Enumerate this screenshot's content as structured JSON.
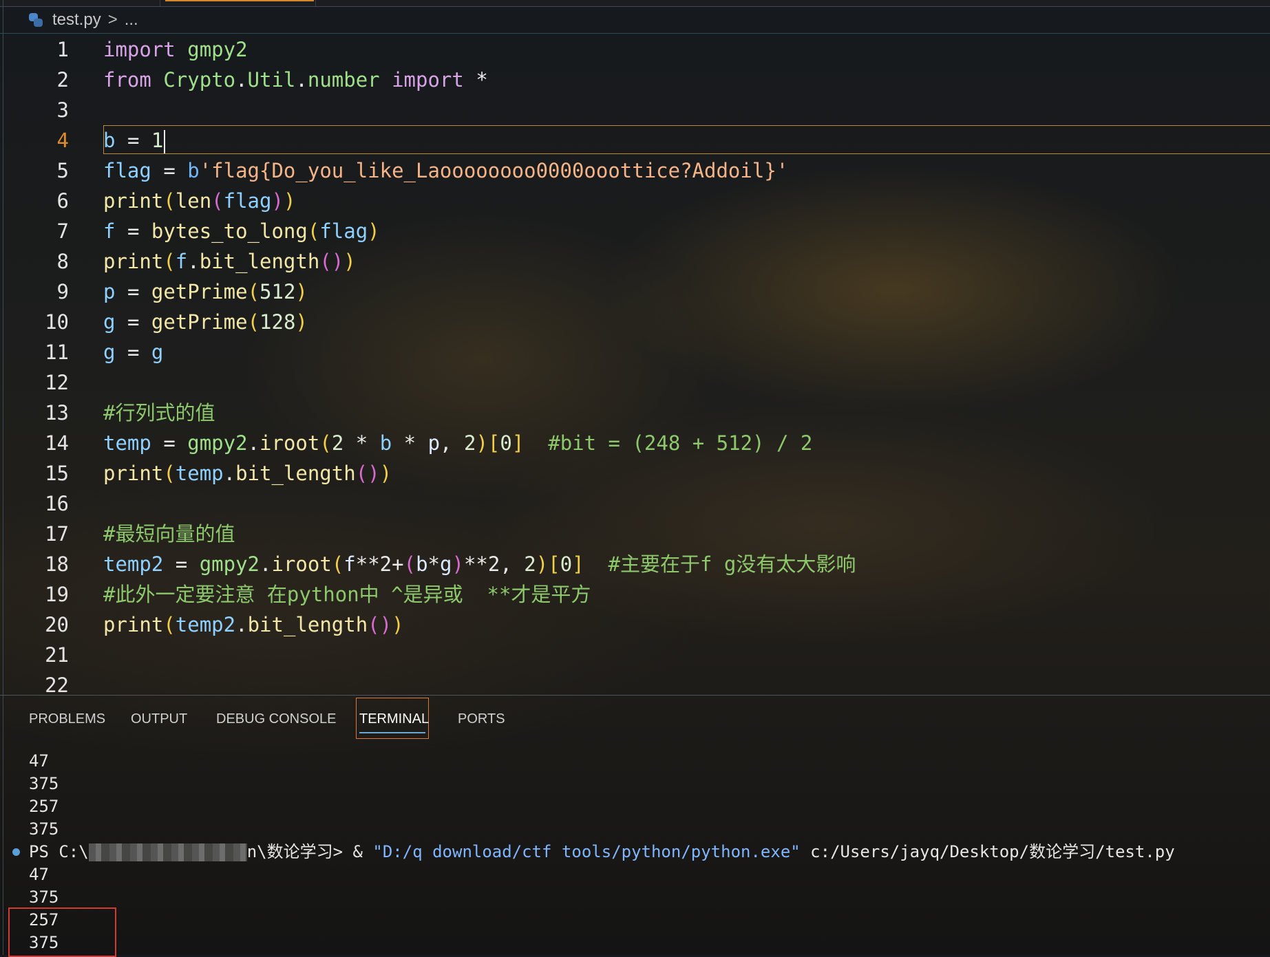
{
  "breadcrumb": {
    "file": "test.py",
    "separator": ">",
    "more": "..."
  },
  "editor": {
    "active_line": 4,
    "lines": [
      {
        "n": "1"
      },
      {
        "n": "2"
      },
      {
        "n": "3"
      },
      {
        "n": "4"
      },
      {
        "n": "5"
      },
      {
        "n": "6"
      },
      {
        "n": "7"
      },
      {
        "n": "8"
      },
      {
        "n": "9"
      },
      {
        "n": "10"
      },
      {
        "n": "11"
      },
      {
        "n": "12"
      },
      {
        "n": "13"
      },
      {
        "n": "14"
      },
      {
        "n": "15"
      },
      {
        "n": "16"
      },
      {
        "n": "17"
      },
      {
        "n": "18"
      },
      {
        "n": "19"
      },
      {
        "n": "20"
      },
      {
        "n": "21"
      },
      {
        "n": "22"
      }
    ],
    "t": {
      "import": "import",
      "gmpy2": "gmpy2",
      "from": "from",
      "crypto": "Crypto",
      "dot": ".",
      "util": "Util",
      "number": "number",
      "star": "*",
      "b": "b",
      "eq": "=",
      "one": "1",
      "flag": "flag",
      "bpref": "b",
      "flagstr": "'flag{Do_you_like_Laoooooooo0000ooottice?Addoil}'",
      "print": "print",
      "lp": "(",
      "rp": ")",
      "len": "len",
      "f": "f",
      "bytes_to_long": "bytes_to_long",
      "bit_length": "bit_length",
      "p": "p",
      "getPrime": "getPrime",
      "n512": "512",
      "n128": "128",
      "g": "g",
      "cm13": "#行列式的值",
      "temp": "temp",
      "iroot": "iroot",
      "n2": "2",
      "mul": "*",
      "comma": ",",
      "lb": "[",
      "rb": "]",
      "n0": "0",
      "cm14": "#bit = (248 + 512) / 2",
      "cm17": "#最短向量的值",
      "temp2": "temp2",
      "pow": "**",
      "plus": "+",
      "pow2": "**2",
      "cm18": "#主要在于f g没有太大影响",
      "cm19": "#此外一定要注意 在python中 ^是异或  **才是平方"
    }
  },
  "panel": {
    "tabs": [
      "PROBLEMS",
      "OUTPUT",
      "DEBUG CONSOLE",
      "TERMINAL",
      "PORTS"
    ],
    "active_tab": "TERMINAL"
  },
  "terminal": {
    "out1": [
      "47",
      "375",
      "257",
      "375"
    ],
    "prompt_prefix": "PS C:\\",
    "prompt_suffix": "n\\数论学习> & ",
    "exe": "\"D:/q download/ctf tools/python/python.exe\"",
    "script": " c:/Users/jayq/Desktop/数论学习/test.py",
    "out2": [
      "47",
      "375",
      "257",
      "375"
    ]
  }
}
